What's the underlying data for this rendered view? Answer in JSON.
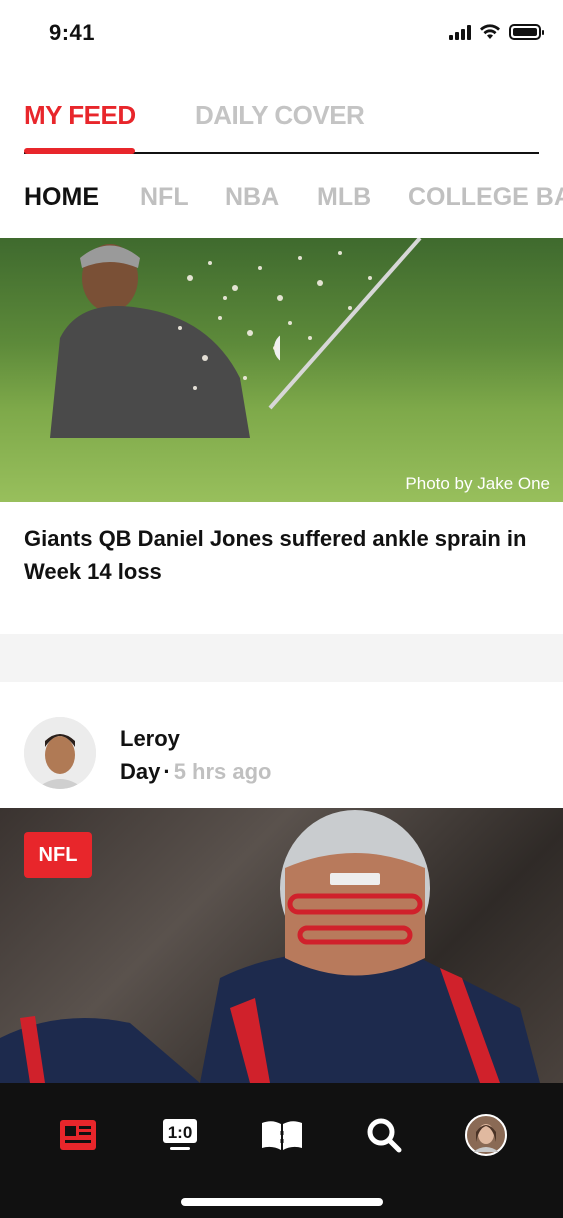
{
  "status_bar": {
    "time": "9:41"
  },
  "top_tabs": [
    {
      "label": "MY FEED",
      "active": true
    },
    {
      "label": "DAILY COVER",
      "active": false
    }
  ],
  "categories": [
    {
      "label": "HOME",
      "active": true
    },
    {
      "label": "NFL",
      "active": false
    },
    {
      "label": "NBA",
      "active": false
    },
    {
      "label": "MLB",
      "active": false
    },
    {
      "label": "COLLEGE BA",
      "active": false
    }
  ],
  "hero": {
    "photo_credit": "Photo by Jake One",
    "headline": "Giants QB Daniel Jones suffered ankle sprain in Week 14 loss"
  },
  "post": {
    "author_first": "Leroy",
    "author_last": "Day",
    "separator": "·",
    "time_ago": "5 hrs ago",
    "badge": "NFL"
  },
  "bottom_nav": [
    {
      "icon": "feed-icon",
      "active": true
    },
    {
      "icon": "scores-icon",
      "active": false
    },
    {
      "icon": "book-icon",
      "active": false
    },
    {
      "icon": "search-icon",
      "active": false
    },
    {
      "icon": "profile-avatar",
      "active": false
    }
  ],
  "colors": {
    "accent": "#e8262b",
    "inactive": "#c0c0c0",
    "nav_bg": "#111111"
  }
}
